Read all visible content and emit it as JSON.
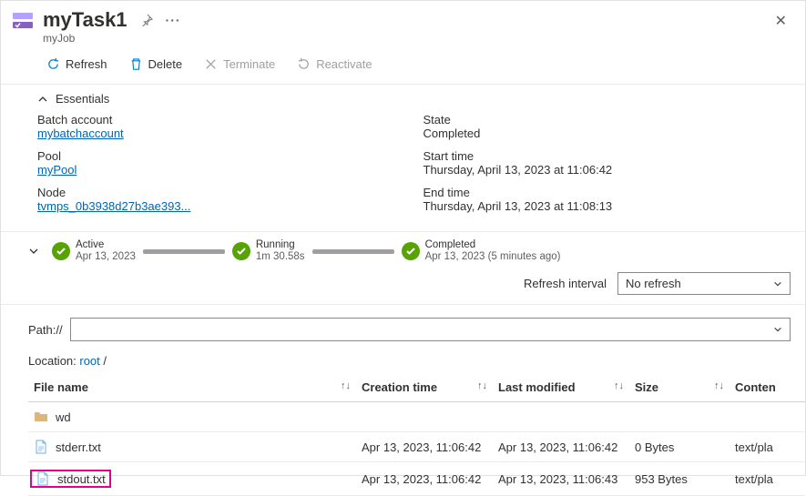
{
  "header": {
    "title": "myTask1",
    "subtitle": "myJob"
  },
  "toolbar": {
    "refresh": "Refresh",
    "delete": "Delete",
    "terminate": "Terminate",
    "reactivate": "Reactivate"
  },
  "essentials": {
    "label": "Essentials",
    "left": {
      "batch_account_label": "Batch account",
      "batch_account_value": "mybatchaccount",
      "pool_label": "Pool",
      "pool_value": "myPool",
      "node_label": "Node",
      "node_value": "tvmps_0b3938d27b3ae393..."
    },
    "right": {
      "state_label": "State",
      "state_value": "Completed",
      "start_label": "Start time",
      "start_value": "Thursday, April 13, 2023 at 11:06:42",
      "end_label": "End time",
      "end_value": "Thursday, April 13, 2023 at 11:08:13"
    }
  },
  "timeline": {
    "active": {
      "title": "Active",
      "sub": "Apr 13, 2023"
    },
    "running": {
      "title": "Running",
      "sub": "1m 30.58s"
    },
    "completed": {
      "title": "Completed",
      "sub": "Apr 13, 2023 (5 minutes ago)"
    }
  },
  "refresh_interval": {
    "label": "Refresh interval",
    "value": "No refresh"
  },
  "path": {
    "label": "Path://"
  },
  "location": {
    "prefix": "Location: ",
    "root": "root",
    "trail": " /"
  },
  "table": {
    "cols": {
      "fname": "File name",
      "ctime": "Creation time",
      "mtime": "Last modified",
      "size": "Size",
      "content": "Conten"
    },
    "rows": [
      {
        "type": "folder",
        "name": "wd",
        "ctime": "",
        "mtime": "",
        "size": "",
        "content": ""
      },
      {
        "type": "file",
        "name": "stderr.txt",
        "ctime": "Apr 13, 2023, 11:06:42",
        "mtime": "Apr 13, 2023, 11:06:42",
        "size": "0 Bytes",
        "content": "text/pla"
      },
      {
        "type": "file",
        "name": "stdout.txt",
        "ctime": "Apr 13, 2023, 11:06:42",
        "mtime": "Apr 13, 2023, 11:06:43",
        "size": "953 Bytes",
        "content": "text/pla",
        "highlight": true
      }
    ]
  }
}
